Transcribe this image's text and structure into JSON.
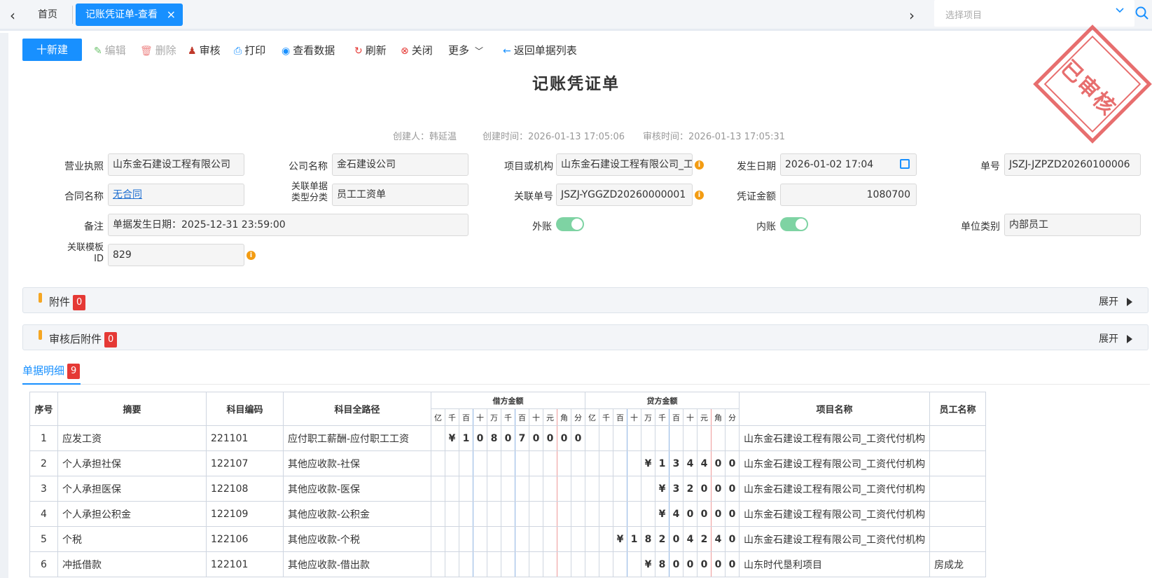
{
  "tabs": {
    "home": "首页",
    "active": "记账凭证单-查看",
    "close": "×",
    "prev": "‹",
    "next": "›"
  },
  "project_select": {
    "placeholder": "选择项目"
  },
  "toolbar": {
    "new": "十新建",
    "edit": "编辑",
    "delete": "删除",
    "audit": "审核",
    "print": "打印",
    "view_data": "查看数据",
    "refresh": "刷新",
    "close": "关闭",
    "more": "更多",
    "back": "返回单据列表"
  },
  "title": "记账凭证单",
  "stamp": "已审核",
  "meta": {
    "creator": "创建人：韩延温",
    "create_time": "创建时间：2026-01-13 17:05:06",
    "audit_time": "审核时间：2026-01-13 17:05:31"
  },
  "form": {
    "business_license": {
      "label": "营业执照",
      "value": "山东金石建设工程有限公司"
    },
    "company_name": {
      "label": "公司名称",
      "value": "金石建设公司"
    },
    "project_org": {
      "label": "项目或机构",
      "value": "山东金石建设工程有限公司_工"
    },
    "date": {
      "label": "发生日期",
      "value": "2026-01-02 17:04"
    },
    "doc_no": {
      "label": "单号",
      "value": "JSZJ-JZPZD20260100006"
    },
    "contract": {
      "label": "合同名称",
      "value": "无合同"
    },
    "related_type": {
      "label_line1": "关联单据",
      "label_line2": "类型分类",
      "value": "员工工资单"
    },
    "related_no": {
      "label": "关联单号",
      "value": "JSZJ-YGGZD20260000001"
    },
    "amount": {
      "label": "凭证金额",
      "value": "1080700"
    },
    "remark": {
      "label": "备注",
      "value": "单据发生日期：2025-12-31 23:59:00"
    },
    "external": {
      "label": "外账"
    },
    "internal": {
      "label": "内账"
    },
    "unit_type": {
      "label": "单位类别",
      "value": "内部员工"
    },
    "template_id": {
      "label_line1": "关联模板",
      "label_line2": "ID",
      "value": "829"
    }
  },
  "panels": {
    "attachment": {
      "title": "附件",
      "count": "0",
      "expand": "展开"
    },
    "post_audit": {
      "title": "审核后附件",
      "count": "0",
      "expand": "展开"
    }
  },
  "detail_tab": {
    "label": "单据明细",
    "count": "9"
  },
  "table": {
    "headers": {
      "seq": "序号",
      "summary": "摘要",
      "code": "科目编码",
      "path": "科目全路径",
      "debit": "借方金额",
      "credit": "贷方金额",
      "project": "项目名称",
      "employee": "员工名称"
    },
    "digit_headers": [
      "亿",
      "千",
      "百",
      "十",
      "万",
      "千",
      "百",
      "十",
      "元",
      "角",
      "分"
    ],
    "rows": [
      {
        "seq": "1",
        "summary": "应发工资",
        "code": "221101",
        "path": "应付职工薪酬-应付职工工资",
        "debit": [
          "",
          "¥",
          "1",
          "0",
          "8",
          "0",
          "7",
          "0",
          "0",
          "0",
          "0"
        ],
        "credit": [
          "",
          "",
          "",
          "",
          "",
          "",
          "",
          "",
          "",
          "",
          ""
        ],
        "project": "山东金石建设工程有限公司_工资代付机构",
        "employee": ""
      },
      {
        "seq": "2",
        "summary": "个人承担社保",
        "code": "122107",
        "path": "其他应收款-社保",
        "debit": [
          "",
          "",
          "",
          "",
          "",
          "",
          "",
          "",
          "",
          "",
          ""
        ],
        "credit": [
          "",
          "",
          "",
          "",
          "¥",
          "1",
          "3",
          "4",
          "4",
          "0",
          "0"
        ],
        "project": "山东金石建设工程有限公司_工资代付机构",
        "employee": ""
      },
      {
        "seq": "3",
        "summary": "个人承担医保",
        "code": "122108",
        "path": "其他应收款-医保",
        "debit": [
          "",
          "",
          "",
          "",
          "",
          "",
          "",
          "",
          "",
          "",
          ""
        ],
        "credit": [
          "",
          "",
          "",
          "",
          "",
          "¥",
          "3",
          "2",
          "0",
          "0",
          "0"
        ],
        "project": "山东金石建设工程有限公司_工资代付机构",
        "employee": ""
      },
      {
        "seq": "4",
        "summary": "个人承担公积金",
        "code": "122109",
        "path": "其他应收款-公积金",
        "debit": [
          "",
          "",
          "",
          "",
          "",
          "",
          "",
          "",
          "",
          "",
          ""
        ],
        "credit": [
          "",
          "",
          "",
          "",
          "",
          "¥",
          "4",
          "0",
          "0",
          "0",
          "0"
        ],
        "project": "山东金石建设工程有限公司_工资代付机构",
        "employee": ""
      },
      {
        "seq": "5",
        "summary": "个税",
        "code": "122106",
        "path": "其他应收款-个税",
        "debit": [
          "",
          "",
          "",
          "",
          "",
          "",
          "",
          "",
          "",
          "",
          ""
        ],
        "credit": [
          "",
          "",
          "¥",
          "1",
          "8",
          "2",
          "0",
          "4",
          "2",
          "4",
          "0"
        ],
        "project": "山东金石建设工程有限公司_工资代付机构",
        "employee": ""
      },
      {
        "seq": "6",
        "summary": "冲抵借款",
        "code": "122101",
        "path": "其他应收款-借出款",
        "debit": [
          "",
          "",
          "",
          "",
          "",
          "",
          "",
          "",
          "",
          "",
          ""
        ],
        "credit": [
          "",
          "",
          "",
          "",
          "¥",
          "8",
          "0",
          "0",
          "0",
          "0",
          "0"
        ],
        "project": "山东时代垦利项目",
        "employee": "房成龙"
      }
    ]
  }
}
